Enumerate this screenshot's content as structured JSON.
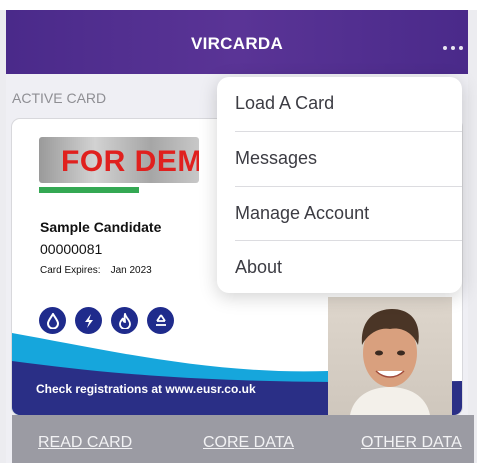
{
  "navbar": {
    "title": "VIRCARDA",
    "more_icon": "ellipsis-icon"
  },
  "section": {
    "label": "ACTIVE CARD"
  },
  "card": {
    "logo_text": "FOR DEMO",
    "candidate_name": "Sample Candidate",
    "candidate_number": "00000081",
    "expires_label": "Card Expires:",
    "expires_value": "Jan 2023",
    "category_icons": [
      "water-drop-icon",
      "electricity-icon",
      "gas-flame-icon",
      "recycling-icon"
    ],
    "check_text": "Check registrations at www.eusr.co.uk",
    "photo": "candidate-photo",
    "colors": {
      "logo_red": "#e0201e",
      "stripe_green": "#34a853",
      "navy": "#1f2b8c",
      "cyan": "#16a6dc"
    }
  },
  "menu": {
    "items": [
      {
        "label": "Load A Card"
      },
      {
        "label": "Messages"
      },
      {
        "label": "Manage Account"
      },
      {
        "label": "About"
      }
    ]
  },
  "bottom_nav": {
    "read_card": "READ CARD",
    "core_data": "CORE DATA",
    "other_data": "OTHER DATA"
  },
  "colors": {
    "navbar_purple": "#4a2a8a",
    "bottom_bar": "#9b9ba3"
  }
}
